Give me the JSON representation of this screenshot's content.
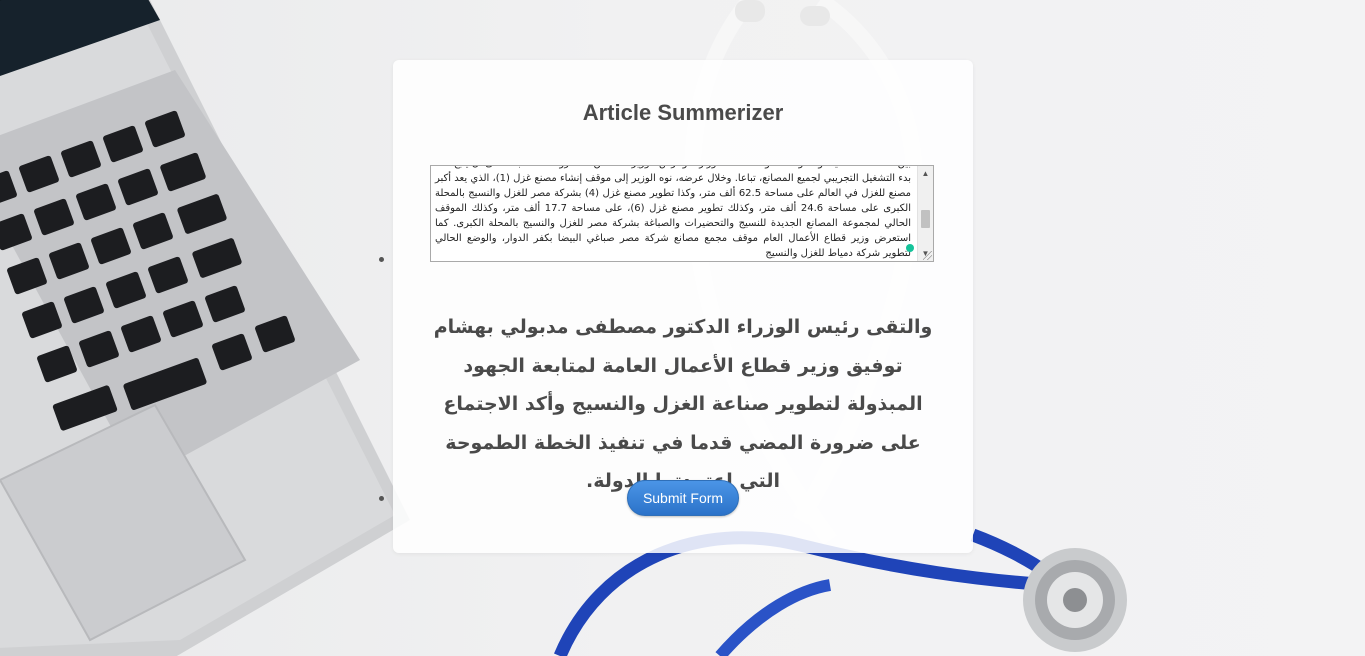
{
  "app": {
    "title": "Article Summerizer"
  },
  "form": {
    "article_text": "بين الصناعات الثقيلة والمتوسطة، وفقا لخطة الوزارة. وعرض الوزير عددا من المشروعات المقبلة، على أن يتبع ذلك بدء التشغيل التجريبي لجميع المصانع، تباعا. وخلال عرضه، نوه الوزير إلى موقف إنشاء مصنع غزل (1)، الذي يعد أكبر مصنع للغزل في العالم على مساحة 62.5 ألف متر، وكذا تطوير مصنع غزل (4) بشركة مصر للغزل والنسيج بالمحلة الكبرى على مساحة 24.6 ألف متر، وكذلك تطوير مصنع غزل (6)، على مساحة 17.7 ألف متر، وكذلك الموقف الحالي لمجموعة المصانع الجديدة للنسيج والتحضيرات والصباغة بشركة مصر للغزل والنسيج بالمحلة الكبرى. كما استعرض وزير قطاع الأعمال العام موقف مجمع مصانع شركة مصر صباغي البيضا بكفر الدوار، والوضع الحالي لتطوير شركة دمياط للغزل والنسيج",
    "submit_label": "Submit Form"
  },
  "summary": {
    "text": "والتقى رئيس الوزراء الدكتور مصطفى مدبولي بهشام توفيق وزير قطاع الأعمال العامة لمتابعة الجهود المبذولة لتطوير صناعة الغزل والنسيج وأكد الاجتماع على ضرورة المضي قدما في تنفيذ الخطة الطموحة التي اعتمدتها الدولة."
  },
  "colors": {
    "accent": "#3a84d8",
    "title_text": "#4a4a4a",
    "card_bg": "#ffffff"
  },
  "icons": {
    "scroll_up": "triangle-up",
    "scroll_down": "triangle-down",
    "grammarly": "green-dot"
  }
}
